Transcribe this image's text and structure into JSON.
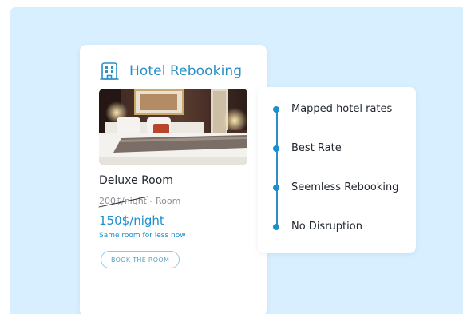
{
  "card": {
    "title": "Hotel Rebooking",
    "icon": "hotel-building-icon",
    "room_name": "Deluxe Room",
    "old_price_struck": "200$/night",
    "old_price_suffix": " - Room",
    "new_price": "150$/night",
    "promo_note": "Same room for less now",
    "book_button_label": "BOOK THE ROOM"
  },
  "features": [
    {
      "label": "Mapped hotel rates"
    },
    {
      "label": "Best Rate"
    },
    {
      "label": "Seemless Rebooking"
    },
    {
      "label": "No Disruption"
    }
  ],
  "colors": {
    "accent": "#1c8fd0",
    "title": "#2a8fc5",
    "background": "#d7efff",
    "text": "#222831",
    "muted": "#8a8f96"
  }
}
